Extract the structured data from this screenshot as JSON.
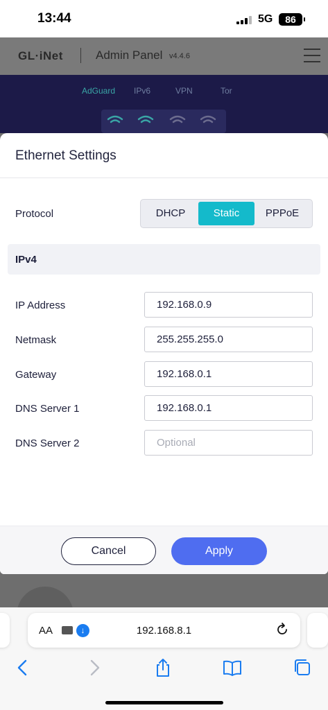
{
  "status_bar": {
    "time": "13:44",
    "network": "5G",
    "battery": "86"
  },
  "app_header": {
    "logo": "GL·iNet",
    "title": "Admin Panel",
    "version": "v4.4.6"
  },
  "banner": {
    "tabs": [
      "AdGuard",
      "IPv6",
      "VPN",
      "Tor"
    ],
    "active_tab": "AdGuard"
  },
  "modal": {
    "title": "Ethernet Settings",
    "protocol": {
      "label": "Protocol",
      "options": [
        "DHCP",
        "Static",
        "PPPoE"
      ],
      "selected": "Static"
    },
    "section_title": "IPv4",
    "fields": [
      {
        "label": "IP Address",
        "value": "192.168.0.9",
        "placeholder": ""
      },
      {
        "label": "Netmask",
        "value": "255.255.255.0",
        "placeholder": ""
      },
      {
        "label": "Gateway",
        "value": "192.168.0.1",
        "placeholder": ""
      },
      {
        "label": "DNS Server 1",
        "value": "192.168.0.1",
        "placeholder": ""
      },
      {
        "label": "DNS Server 2",
        "value": "",
        "placeholder": "Optional"
      }
    ],
    "cancel_label": "Cancel",
    "apply_label": "Apply"
  },
  "browser": {
    "text_size_label": "AA",
    "url": "192.168.8.1"
  },
  "colors": {
    "accent_teal": "#14bacb",
    "apply_blue": "#4f6df0",
    "banner_navy": "#1c1a48",
    "text_dark": "#1d1f3a"
  }
}
